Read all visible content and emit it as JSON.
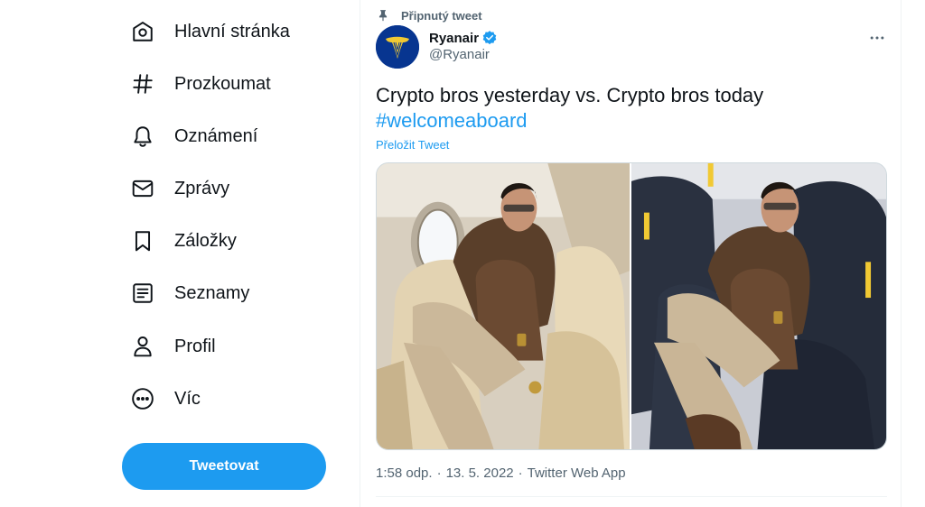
{
  "sidebar": {
    "items": [
      {
        "label": "Hlavní stránka",
        "icon": "home-icon"
      },
      {
        "label": "Prozkoumat",
        "icon": "hashtag-icon"
      },
      {
        "label": "Oznámení",
        "icon": "bell-icon"
      },
      {
        "label": "Zprávy",
        "icon": "envelope-icon"
      },
      {
        "label": "Záložky",
        "icon": "bookmark-icon"
      },
      {
        "label": "Seznamy",
        "icon": "list-icon"
      },
      {
        "label": "Profil",
        "icon": "person-icon"
      },
      {
        "label": "Víc",
        "icon": "more-circle-icon"
      }
    ],
    "tweet_button": "Tweetovat"
  },
  "tweet": {
    "pinned_label": "Připnutý tweet",
    "author": {
      "name": "Ryanair",
      "handle": "@Ryanair",
      "verified": true
    },
    "text": "Crypto bros yesterday vs. Crypto bros today",
    "hashtag": "#welcomeaboard",
    "translate_label": "Přeložit Tweet",
    "media": [
      {
        "alt": "Man in patterned polo seated in cream leather private jet seat"
      },
      {
        "alt": "Same man seated in dark blue budget airline seat with yellow headrest trim"
      }
    ],
    "meta": {
      "time": "1:58 odp.",
      "separator": "·",
      "date": "13. 5. 2022",
      "source": "Twitter Web App"
    }
  },
  "colors": {
    "accent": "#1d9bf0",
    "text_primary": "#0f1419",
    "text_secondary": "#536471",
    "border": "#eff3f4",
    "ryanair_blue": "#073590",
    "ryanair_yellow": "#f1c933"
  }
}
